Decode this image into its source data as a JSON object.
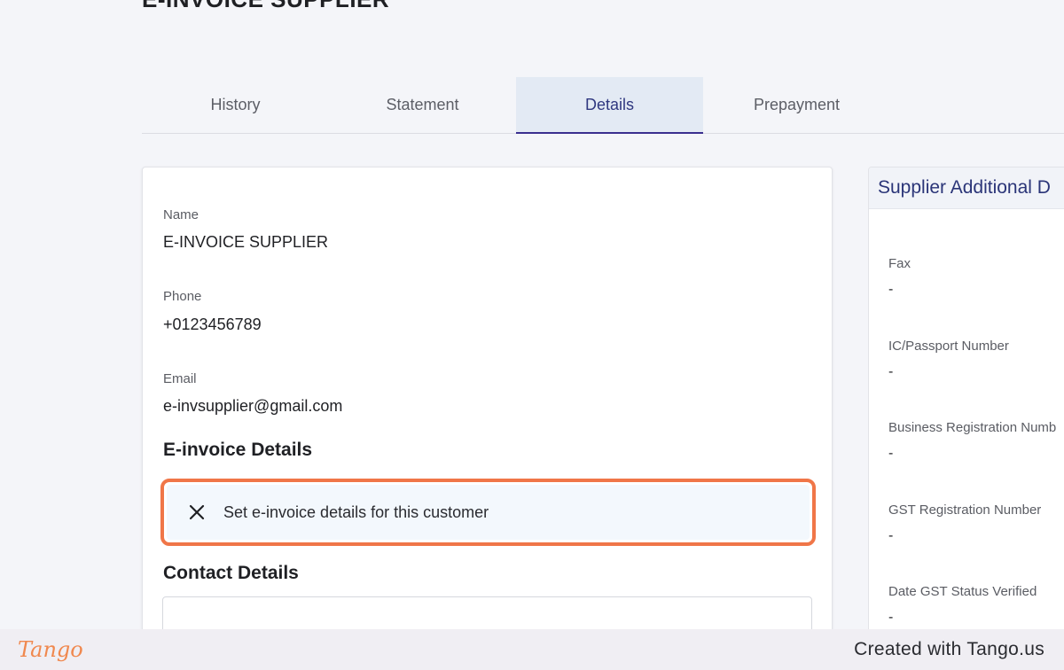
{
  "header": {
    "title": "E-INVOICE SUPPLIER"
  },
  "tabs": [
    {
      "label": "History",
      "active": false
    },
    {
      "label": "Statement",
      "active": false
    },
    {
      "label": "Details",
      "active": true
    },
    {
      "label": "Prepayment",
      "active": false
    }
  ],
  "details": {
    "name_label": "Name",
    "name_value": "E-INVOICE SUPPLIER",
    "phone_label": "Phone",
    "phone_value": "+0123456789",
    "email_label": "Email",
    "email_value": "e-invsupplier@gmail.com",
    "einvoice_title": "E-invoice Details",
    "einvoice_action": "Set e-invoice details for this customer",
    "einvoice_icon": "close-icon",
    "contact_title": "Contact Details"
  },
  "side": {
    "title": "Supplier Additional D",
    "fields": [
      {
        "label": "Fax",
        "value": "-"
      },
      {
        "label": "IC/Passport Number",
        "value": "-"
      },
      {
        "label": "Business Registration Numb",
        "value": "-"
      },
      {
        "label": "GST Registration Number",
        "value": "-"
      },
      {
        "label": "Date GST Status Verified",
        "value": "-"
      }
    ]
  },
  "footer": {
    "logo": "Tango",
    "credit": "Created with Tango.us"
  },
  "colors": {
    "highlight": "#f07648",
    "accent": "#3a2e8f",
    "active_tab_bg": "#e3eaf4"
  }
}
